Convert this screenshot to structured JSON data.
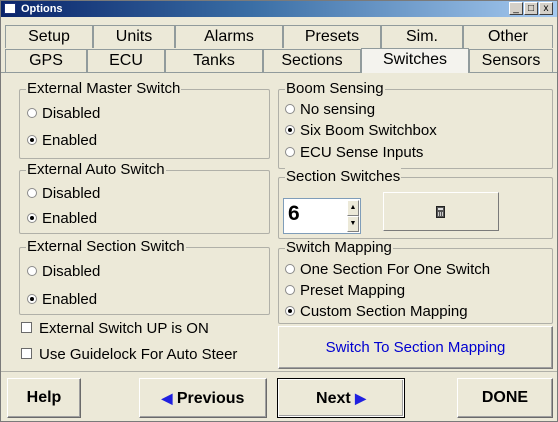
{
  "window": {
    "title": "Options",
    "controls": {
      "minimize": "_",
      "maximize": "□",
      "close": "x"
    }
  },
  "tabs": {
    "row1": [
      "Setup",
      "Units",
      "Alarms",
      "Presets",
      "Sim.",
      "Other"
    ],
    "row2": [
      "GPS",
      "ECU",
      "Tanks",
      "Sections",
      "Switches",
      "Sensors"
    ],
    "active": "Switches"
  },
  "external_master_switch": {
    "title": "External Master Switch",
    "options": [
      "Disabled",
      "Enabled"
    ],
    "selected": "Enabled"
  },
  "external_auto_switch": {
    "title": "External Auto Switch",
    "options": [
      "Disabled",
      "Enabled"
    ],
    "selected": "Enabled"
  },
  "external_section_switch": {
    "title": "External Section Switch",
    "options": [
      "Disabled",
      "Enabled"
    ],
    "selected": "Enabled"
  },
  "checkboxes": [
    {
      "label": "External Switch UP is ON",
      "checked": false
    },
    {
      "label": "Use Guidelock For Auto Steer",
      "checked": false
    }
  ],
  "boom_sensing": {
    "title": "Boom Sensing",
    "options": [
      "No sensing",
      "Six Boom Switchbox",
      "ECU Sense Inputs"
    ],
    "selected": "Six Boom Switchbox"
  },
  "section_switches": {
    "title": "Section Switches",
    "value": "6",
    "calc_icon": "calculator-icon"
  },
  "switch_mapping": {
    "title": "Switch Mapping",
    "options": [
      "One Section For One Switch",
      "Preset Mapping",
      "Custom Section Mapping"
    ],
    "selected": "Custom Section Mapping"
  },
  "mapping_button": {
    "label": "Switch To Section Mapping"
  },
  "footer": {
    "help": "Help",
    "previous": "Previous",
    "next": "Next",
    "done": "DONE",
    "prev_arrow": "◀",
    "next_arrow": "▶"
  },
  "colors": {
    "link_blue": "#0000d0",
    "arrow_blue": "#2020e0",
    "title_blue": "#0a246a"
  }
}
